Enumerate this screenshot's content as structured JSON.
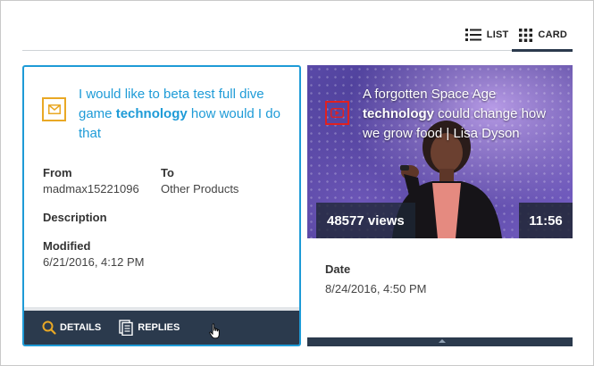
{
  "view_toggle": {
    "list_label": "LIST",
    "card_label": "CARD",
    "active": "card"
  },
  "card1": {
    "title_pre": "I would like to beta test full dive game ",
    "title_highlight": "technology",
    "title_post": " how would I do that",
    "from_label": "From",
    "from_value": "madmax15221096",
    "to_label": "To",
    "to_value": "Other Products",
    "description_label": "Description",
    "modified_label": "Modified",
    "modified_value": "6/21/2016, 4:12 PM",
    "details_label": "DETAILS",
    "replies_label": "REPLIES",
    "icon": "mail-icon",
    "accent_color": "#e9a825"
  },
  "card2": {
    "title_pre": "A forgotten Space Age ",
    "title_highlight": "technology",
    "title_post": " could change how we grow food | Lisa Dyson",
    "views": "48577 views",
    "duration": "11:56",
    "date_label": "Date",
    "date_value": "8/24/2016, 4:50 PM",
    "icon": "play-icon",
    "accent_color": "#e02020"
  },
  "colors": {
    "link_blue": "#1e9bd7",
    "footer_navy": "#2b3a4d"
  }
}
